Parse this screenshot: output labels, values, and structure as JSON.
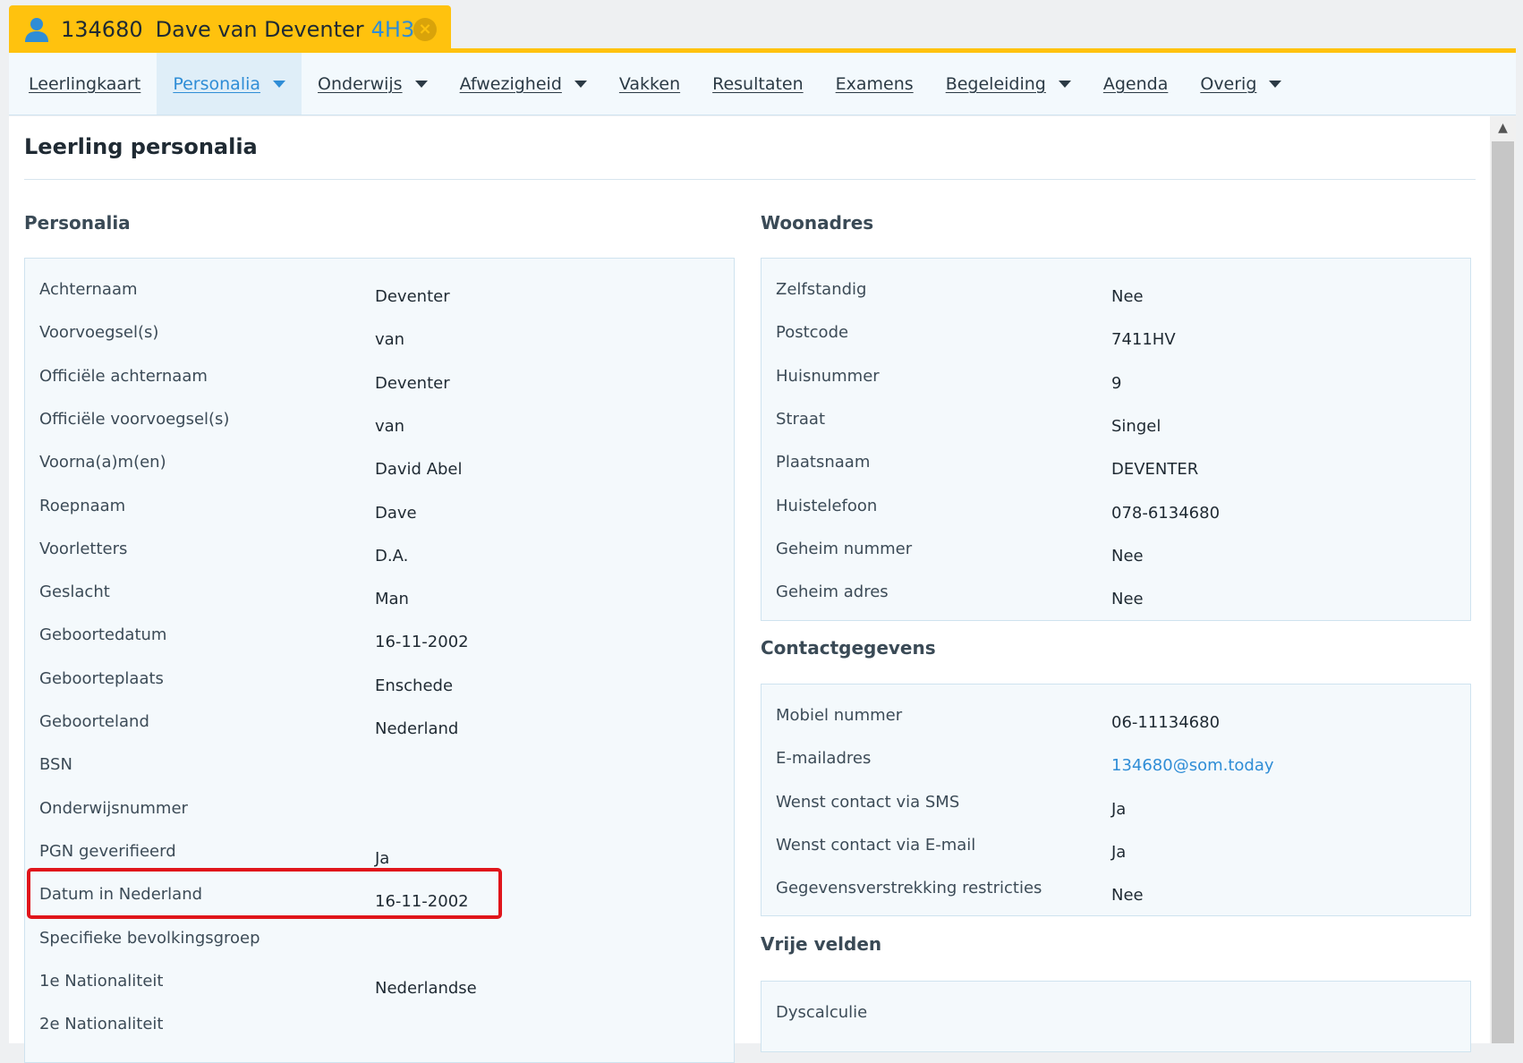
{
  "tab": {
    "number": "134680",
    "name": "Dave van Deventer",
    "klas": "4H3"
  },
  "nav": [
    {
      "label": "Leerlingkaart",
      "dropdown": false,
      "active": false
    },
    {
      "label": "Personalia",
      "dropdown": true,
      "active": true
    },
    {
      "label": "Onderwijs",
      "dropdown": true,
      "active": false
    },
    {
      "label": "Afwezigheid",
      "dropdown": true,
      "active": false
    },
    {
      "label": "Vakken",
      "dropdown": false,
      "active": false
    },
    {
      "label": "Resultaten",
      "dropdown": false,
      "active": false
    },
    {
      "label": "Examens",
      "dropdown": false,
      "active": false
    },
    {
      "label": "Begeleiding",
      "dropdown": true,
      "active": false
    },
    {
      "label": "Agenda",
      "dropdown": false,
      "active": false
    },
    {
      "label": "Overig",
      "dropdown": true,
      "active": false
    }
  ],
  "page_title": "Leerling personalia",
  "personalia": {
    "title": "Personalia",
    "rows": [
      {
        "label": "Achternaam",
        "value": "Deventer"
      },
      {
        "label": "Voorvoegsel(s)",
        "value": "van"
      },
      {
        "label": "Officiële achternaam",
        "value": "Deventer"
      },
      {
        "label": "Officiële voorvoegsel(s)",
        "value": "van"
      },
      {
        "label": "Voorna(a)m(en)",
        "value": "David Abel"
      },
      {
        "label": "Roepnaam",
        "value": "Dave"
      },
      {
        "label": "Voorletters",
        "value": "D.A."
      },
      {
        "label": "Geslacht",
        "value": "Man"
      },
      {
        "label": "Geboortedatum",
        "value": "16-11-2002"
      },
      {
        "label": "Geboorteplaats",
        "value": "Enschede"
      },
      {
        "label": "Geboorteland",
        "value": "Nederland"
      },
      {
        "label": "BSN",
        "value": ""
      },
      {
        "label": "Onderwijsnummer",
        "value": ""
      },
      {
        "label": "PGN geverifieerd",
        "value": "Ja"
      },
      {
        "label": "Datum in Nederland",
        "value": "16-11-2002"
      },
      {
        "label": "Specifieke bevolkingsgroep",
        "value": ""
      },
      {
        "label": "1e Nationaliteit",
        "value": "Nederlandse"
      },
      {
        "label": "2e Nationaliteit",
        "value": ""
      }
    ]
  },
  "woonadres": {
    "title": "Woonadres",
    "rows": [
      {
        "label": "Zelfstandig",
        "value": "Nee"
      },
      {
        "label": "Postcode",
        "value": "7411HV"
      },
      {
        "label": "Huisnummer",
        "value": "9"
      },
      {
        "label": "Straat",
        "value": "Singel"
      },
      {
        "label": "Plaatsnaam",
        "value": "DEVENTER"
      },
      {
        "label": "Huistelefoon",
        "value": "078-6134680"
      },
      {
        "label": "Geheim nummer",
        "value": "Nee"
      },
      {
        "label": "Geheim adres",
        "value": "Nee"
      }
    ]
  },
  "contact": {
    "title": "Contactgegevens",
    "rows": [
      {
        "label": "Mobiel nummer",
        "value": "06-11134680"
      },
      {
        "label": "E-mailadres",
        "value": "134680@som.today"
      },
      {
        "label": "Wenst contact via SMS",
        "value": "Ja"
      },
      {
        "label": "Wenst contact via E-mail",
        "value": "Ja"
      },
      {
        "label": "Gegevensverstrekking restricties",
        "value": "Nee"
      }
    ]
  },
  "vrije_velden": {
    "title": "Vrije velden",
    "rows": [
      {
        "label": "Dyscalculie",
        "value": ""
      }
    ]
  },
  "colors": {
    "tab_yellow": "#ffc20e",
    "accent_blue": "#2f8dd6",
    "highlight_red": "#e0151b"
  }
}
